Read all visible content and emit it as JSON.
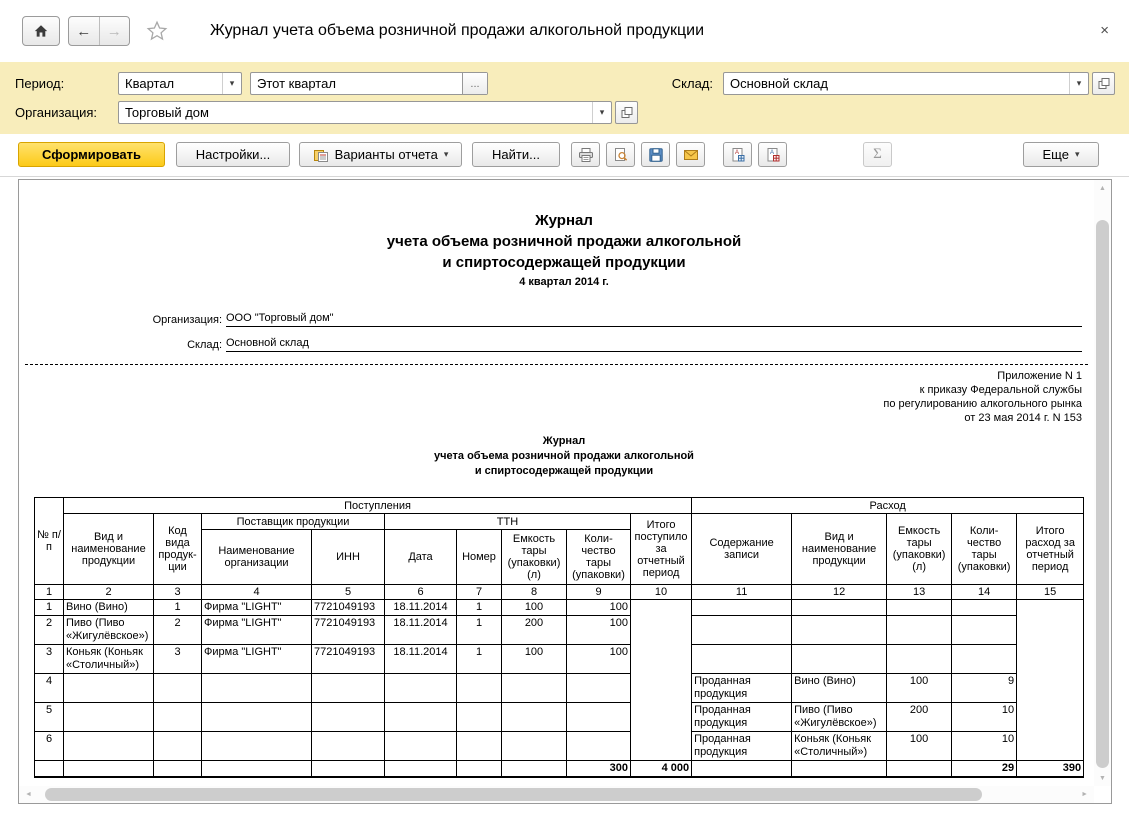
{
  "window": {
    "title": "Журнал учета объема розничной продажи алкогольной продукции"
  },
  "icons": {
    "back": "←",
    "forward": "→",
    "close": "×",
    "dropdown": "▾",
    "ellipsis": "...",
    "scroll_up": "▲",
    "scroll_down": "▼",
    "scroll_left": "◄",
    "scroll_right": "►"
  },
  "filters": {
    "period_label": "Период:",
    "period_kind": "Квартал",
    "period_value": "Этот квартал",
    "org_label": "Организация:",
    "org_value": "Торговый дом",
    "warehouse_label": "Склад:",
    "warehouse_value": "Основной склад"
  },
  "toolbar": {
    "generate": "Сформировать",
    "settings": "Настройки...",
    "report_variants": "Варианты отчета",
    "find": "Найти...",
    "sum": "Σ",
    "more": "Еще"
  },
  "report": {
    "title1": "Журнал",
    "title2": "учета объема розничной продажи алкогольной",
    "title3": "и спиртосодержащей продукции",
    "period": "4 квартал 2014 г.",
    "org_label": "Организация:",
    "org_value": "ООО \"Торговый дом\"",
    "wh_label": "Склад:",
    "wh_value": "Основной склад",
    "appendix1": "Приложение N 1",
    "appendix2": "к приказу Федеральной службы",
    "appendix3": "по регулированию алкогольного рынка",
    "appendix4": "от 23 мая 2014 г. N 153",
    "subtitle1": "Журнал",
    "subtitle2": "учета объема розничной продажи алкогольной",
    "subtitle3": "и спиртосодержащей продукции",
    "table": {
      "h": {
        "num": "№ п/п",
        "receipts": "Поступления",
        "expense": "Расход",
        "prod": "Вид и наименование продукции",
        "code": "Код вида продук-ции",
        "supplier": "Поставщик продукции",
        "supplier_name": "Наименование организации",
        "inn": "ИНН",
        "ttn": "ТТН",
        "date": "Дата",
        "number": "Номер",
        "capacity": "Емкость тары (упаковки) (л)",
        "qty": "Коли-чество тары (упаковки)",
        "total_in": "Итого поступило за отчетный период",
        "content": "Содержание записи",
        "exp_prod": "Вид и наименование продукции",
        "exp_capacity": "Емкость тары (упаковки) (л)",
        "exp_qty": "Коли-чество тары (упаковки)",
        "total_out": "Итого расход за отчетный период"
      },
      "nums": [
        "1",
        "2",
        "3",
        "4",
        "5",
        "6",
        "7",
        "8",
        "9",
        "10",
        "11",
        "12",
        "13",
        "14",
        "15"
      ],
      "rows": [
        {
          "n": "1",
          "name": "Вино (Вино)",
          "code": "1",
          "supplier": "Фирма \"LIGHT\"",
          "inn": "7721049193",
          "date": "18.11.2014",
          "num": "1",
          "cap": "100",
          "qty": "100",
          "content": "",
          "exp_name": "",
          "exp_cap": "",
          "exp_qty": ""
        },
        {
          "n": "2",
          "name": "Пиво (Пиво «Жигулёвское»)",
          "code": "2",
          "supplier": "Фирма \"LIGHT\"",
          "inn": "7721049193",
          "date": "18.11.2014",
          "num": "1",
          "cap": "200",
          "qty": "100",
          "content": "",
          "exp_name": "",
          "exp_cap": "",
          "exp_qty": ""
        },
        {
          "n": "3",
          "name": "Коньяк (Коньяк «Столичный»)",
          "code": "3",
          "supplier": "Фирма \"LIGHT\"",
          "inn": "7721049193",
          "date": "18.11.2014",
          "num": "1",
          "cap": "100",
          "qty": "100",
          "content": "",
          "exp_name": "",
          "exp_cap": "",
          "exp_qty": ""
        },
        {
          "n": "4",
          "name": "",
          "code": "",
          "supplier": "",
          "inn": "",
          "date": "",
          "num": "",
          "cap": "",
          "qty": "",
          "content": "Проданная продукция",
          "exp_name": "Вино (Вино)",
          "exp_cap": "100",
          "exp_qty": "9"
        },
        {
          "n": "5",
          "name": "",
          "code": "",
          "supplier": "",
          "inn": "",
          "date": "",
          "num": "",
          "cap": "",
          "qty": "",
          "content": "Проданная продукция",
          "exp_name": "Пиво (Пиво «Жигулёвское»)",
          "exp_cap": "200",
          "exp_qty": "10"
        },
        {
          "n": "6",
          "name": "",
          "code": "",
          "supplier": "",
          "inn": "",
          "date": "",
          "num": "",
          "cap": "",
          "qty": "",
          "content": "Проданная продукция",
          "exp_name": "Коньяк (Коньяк «Столичный»)",
          "exp_cap": "100",
          "exp_qty": "10"
        }
      ],
      "totals": {
        "qty": "300",
        "received": "4 000",
        "exp_qty": "29",
        "expense": "390"
      }
    }
  }
}
